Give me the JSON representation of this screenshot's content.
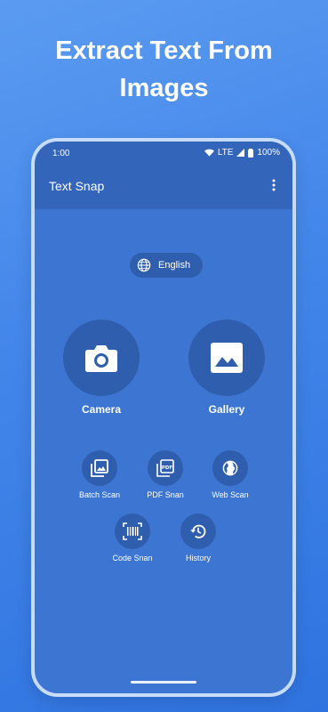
{
  "headline": {
    "line1": "Extract Text From",
    "line2": "Images"
  },
  "status_bar": {
    "time": "1:00",
    "network": "LTE",
    "battery": "100%"
  },
  "app_bar": {
    "title": "Text Snap",
    "menu_icon": "more-vert-icon"
  },
  "language": {
    "label": "English",
    "icon": "globe-icon"
  },
  "primary_actions": [
    {
      "label": "Camera",
      "icon": "camera-icon"
    },
    {
      "label": "Gallery",
      "icon": "image-icon"
    }
  ],
  "secondary_actions": [
    {
      "label": "Batch Scan",
      "icon": "batch-images-icon"
    },
    {
      "label": "PDF Snan",
      "icon": "pdf-icon"
    },
    {
      "label": "Web Scan",
      "icon": "globe-icon"
    },
    {
      "label": "Code Snan",
      "icon": "barcode-icon"
    },
    {
      "label": "History",
      "icon": "history-icon"
    }
  ],
  "colors": {
    "background": "#4487ea",
    "screen": "#3d76d2",
    "appbar": "#3365bb",
    "button": "#2f5eaf"
  }
}
